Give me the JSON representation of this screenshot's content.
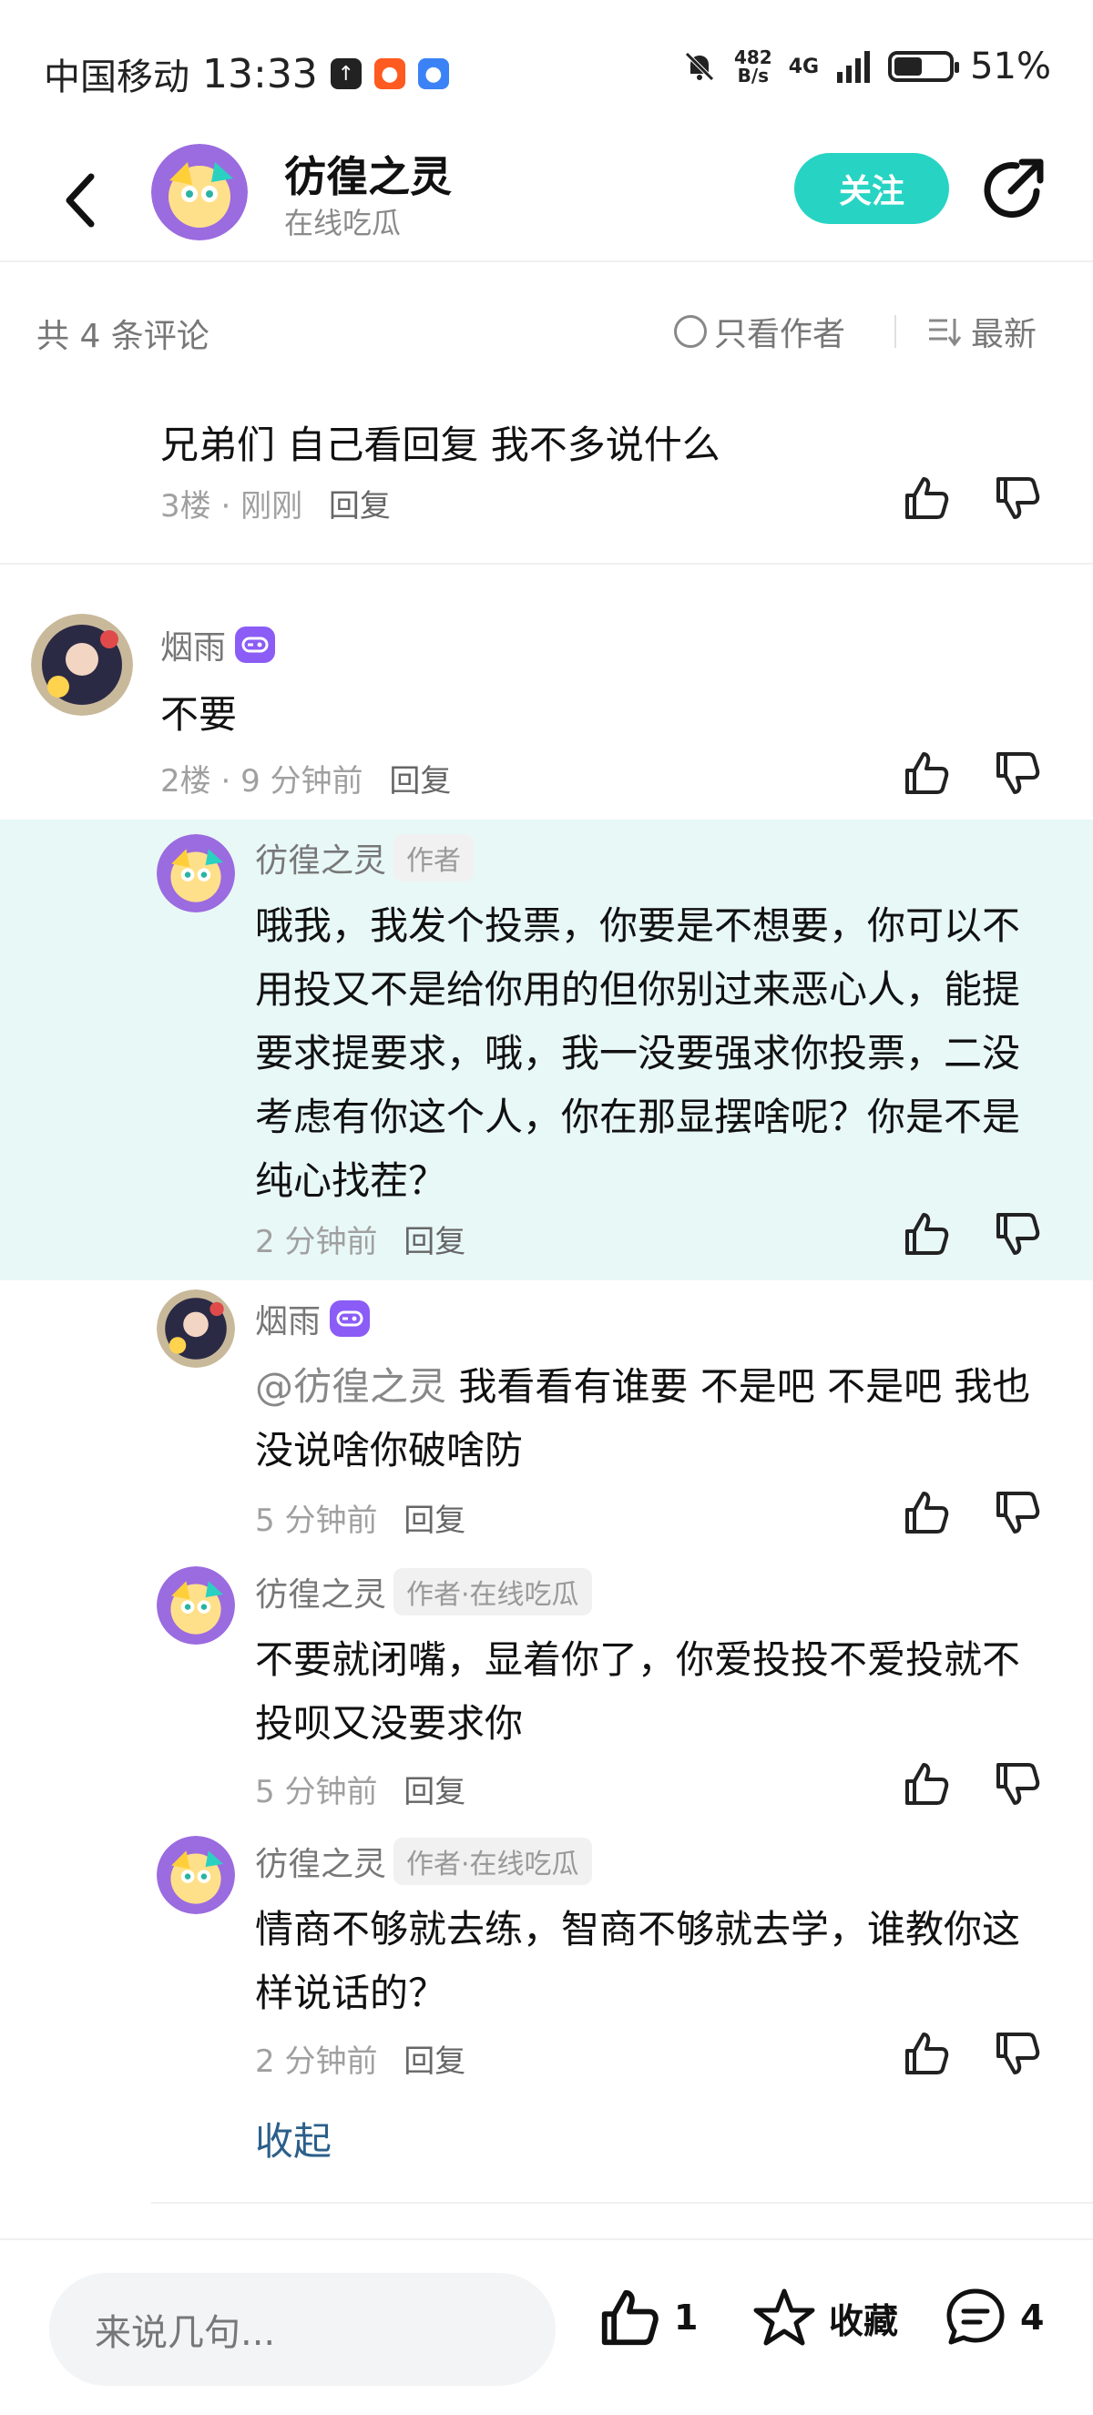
{
  "statusbar": {
    "carrier": "中国移动",
    "time": "13:33",
    "speed_value": "482",
    "speed_unit": "B/s",
    "network": "4G",
    "battery_pct": "51%",
    "battery_level": 0.51
  },
  "header": {
    "name": "彷徨之灵",
    "subtitle": "在线吃瓜",
    "follow_label": "关注"
  },
  "comment_bar": {
    "count": "共 4 条评论",
    "author_only": "只看作者",
    "sort": "最新"
  },
  "comments": {
    "floor3": {
      "text": "兄弟们 自己看回复 我不多说什么",
      "floor": "3楼",
      "time": "刚刚",
      "reply_label": "回复"
    },
    "floor2": {
      "user": "烟雨",
      "text": "不要",
      "floor": "2楼",
      "time": "9 分钟前",
      "reply_label": "回复",
      "replies": [
        {
          "user": "彷徨之灵",
          "tag": "作者",
          "text": "哦我，我发个投票，你要是不想要，你可以不用投又不是给你用的但你别过来恶心人，能提要求提要求，哦，我一没要强求你投票，二没考虑有你这个人，你在那显摆啥呢？你是不是纯心找茬？",
          "time": "2 分钟前",
          "reply_label": "回复"
        },
        {
          "user": "烟雨",
          "mention": "@彷徨之灵",
          "text": "我看看有谁要 不是吧 不是吧 我也没说啥你破啥防",
          "time": "5 分钟前",
          "reply_label": "回复"
        },
        {
          "user": "彷徨之灵",
          "tag": "作者·在线吃瓜",
          "text": "不要就闭嘴，显着你了，你爱投投不爱投就不投呗又没要求你",
          "time": "5 分钟前",
          "reply_label": "回复"
        },
        {
          "user": "彷徨之灵",
          "tag": "作者·在线吃瓜",
          "text": "情商不够就去练，智商不够就去学，谁教你这样说话的？",
          "time": "2 分钟前",
          "reply_label": "回复"
        }
      ],
      "collapse_label": "收起"
    }
  },
  "bottombar": {
    "placeholder": "来说几句...",
    "like_count": "1",
    "favorite_label": "收藏",
    "comment_count": "4"
  },
  "colors": {
    "accent": "#27d4c3",
    "highlight_bg": "#e8f8f6",
    "link": "#2b5f8a",
    "badge": "#8b5cf6"
  }
}
